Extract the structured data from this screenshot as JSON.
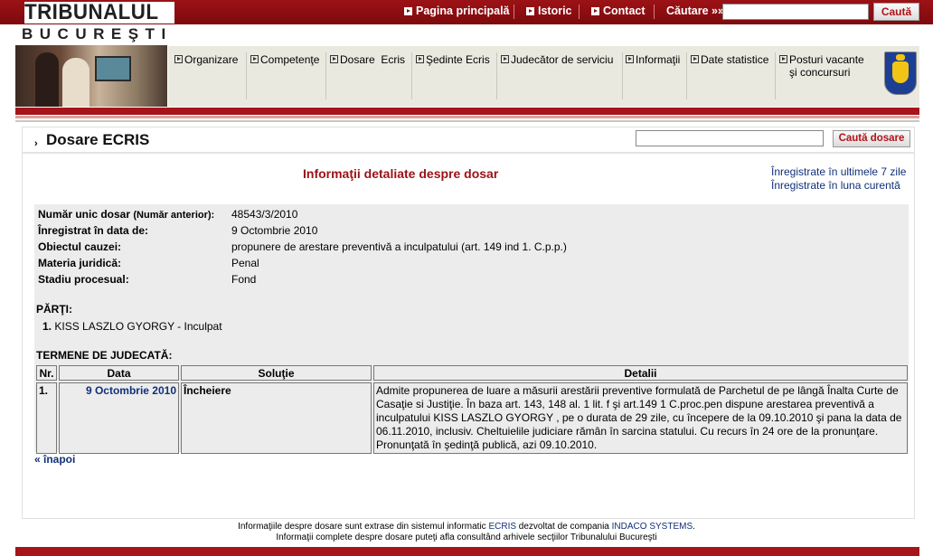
{
  "brand": {
    "line1": "TRIBUNALUL",
    "line2": "BUCUREŞTI"
  },
  "topnav": {
    "items": [
      "Pagina principală",
      "Istoric",
      "Contact"
    ],
    "search_label": "Căutare »»",
    "search_value": "",
    "search_button": "Caută"
  },
  "menu": {
    "items": [
      "Organizare",
      "Competenţe",
      "Dosare  Ecris",
      "Şedinte Ecris",
      "Judecător de serviciu",
      "Informaţii",
      "Date statistice",
      "Posturi vacante",
      "şi concursuri"
    ]
  },
  "page": {
    "title": "Dosare ECRIS",
    "search_value": "",
    "search_button": "Caută dosare",
    "subtitle": "Informaţii detaliate despre dosar",
    "link_7days": "Înregistrate în ultimele 7 zile",
    "link_month": "Înregistrate în luna curentă"
  },
  "dosar": {
    "label_numar": "Număr unic dosar",
    "label_numar_anterior": "(Număr anterior):",
    "numar": "48543/3/2010",
    "label_data": "Înregistrat în data de:",
    "data": "9 Octombrie 2010",
    "label_obiect": "Obiectul cauzei:",
    "obiect": "propunere de arestare preventivă a inculpatului (art. 149 ind 1. C.p.p.)",
    "label_materia": "Materia juridică:",
    "materia": "Penal",
    "label_stadiu": "Stadiu procesual:",
    "stadiu": "Fond"
  },
  "parti": {
    "heading": "PĂRŢI:",
    "items": [
      {
        "nr": "1.",
        "text": "KISS LASZLO GYORGY - Inculpat"
      }
    ]
  },
  "termene": {
    "heading": "TERMENE DE JUDECATĂ:",
    "columns": [
      "Nr.",
      "Data",
      "Soluţie",
      "Detalii"
    ],
    "rows": [
      {
        "nr": "1.",
        "data": "9 Octombrie 2010",
        "solutie": "Încheiere",
        "detalii": "Admite propunerea de luare a măsurii arestării preventive formulată de Parchetul de pe lângă Înalta Curte de Casaţie si Justiţie. În baza art. 143, 148 al. 1 lit. f şi art.149 1 C.proc.pen dispune arestarea preventivă a inculpatului KISS LASZLO GYORGY , pe o durata de 29 zile, cu începere de la 09.10.2010 şi pana la data de 06.11.2010, inclusiv. Cheltuielile judiciare rămân în sarcina statului. Cu recurs în 24 ore de la pronunţare. Pronunţată în şedinţă publică, azi 09.10.2010."
      }
    ]
  },
  "back_link": "« înapoi",
  "footer": {
    "line1_a": "Informaţiile despre dosare sunt extrase din sistemul informatic",
    "line1_ecris": "ECRIS",
    "line1_b": "dezvoltat de compania",
    "line1_indaco": "INDACO SYSTEMS",
    "line2": "Informaţii complete despre dosare puteţi afla consultând arhivele secţiilor Tribunalului Bucureşti"
  },
  "colors": {
    "brand_red": "#a51519",
    "link_blue": "#10307a",
    "title_red": "#9b1116"
  }
}
